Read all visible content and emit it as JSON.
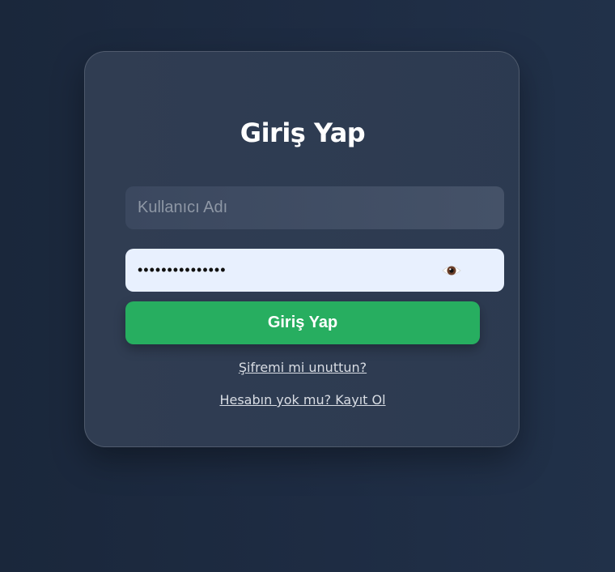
{
  "login": {
    "title": "Giriş Yap",
    "username": {
      "placeholder": "Kullanıcı Adı",
      "value": ""
    },
    "password": {
      "value": "•••••••••••••••",
      "toggle_icon": "eye-icon"
    },
    "submit_label": "Giriş Yap",
    "forgot_link": "Şifremi mi unuttun?",
    "register_link": "Hesabın yok mu? Kayıt Ol"
  },
  "colors": {
    "background": "#1e2c43",
    "card": "#2f3d53",
    "accent_button": "#27ae60",
    "password_field": "#e8f0fe"
  }
}
